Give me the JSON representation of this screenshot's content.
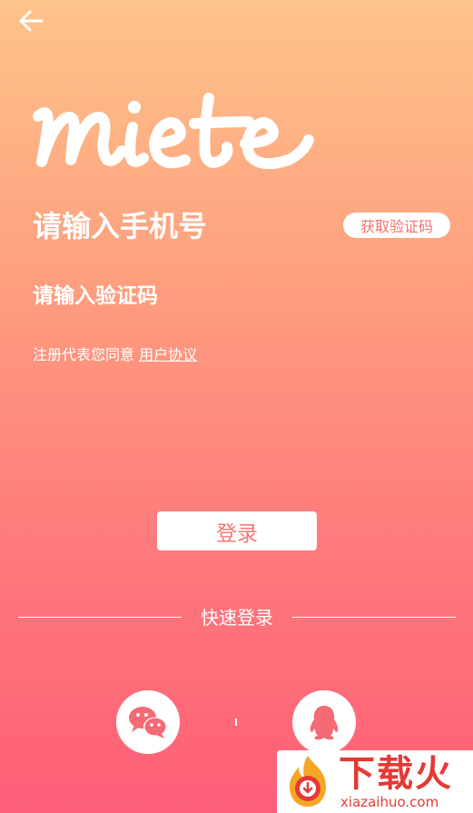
{
  "colors": {
    "gradient_top": "#FEC48A",
    "gradient_bottom": "#FE5F77",
    "accent": "#F4716F",
    "button_text": "#F87776",
    "watermark_red": "#E53935"
  },
  "nav": {
    "back_icon": "arrow-left-icon"
  },
  "logo": {
    "text": "miete"
  },
  "form": {
    "phone_placeholder": "请输入手机号",
    "get_code_label": "获取验证码",
    "code_placeholder": "请输入验证码"
  },
  "agreement": {
    "prefix": "注册代表您同意",
    "link": "用户协议"
  },
  "login_button": {
    "label": "登录"
  },
  "quick_login": {
    "label": "快速登录",
    "providers": [
      {
        "icon": "wechat-icon"
      },
      {
        "icon": "qq-icon"
      }
    ]
  },
  "watermark": {
    "title": "下载火",
    "subtitle": "xiazaihuo.com"
  }
}
